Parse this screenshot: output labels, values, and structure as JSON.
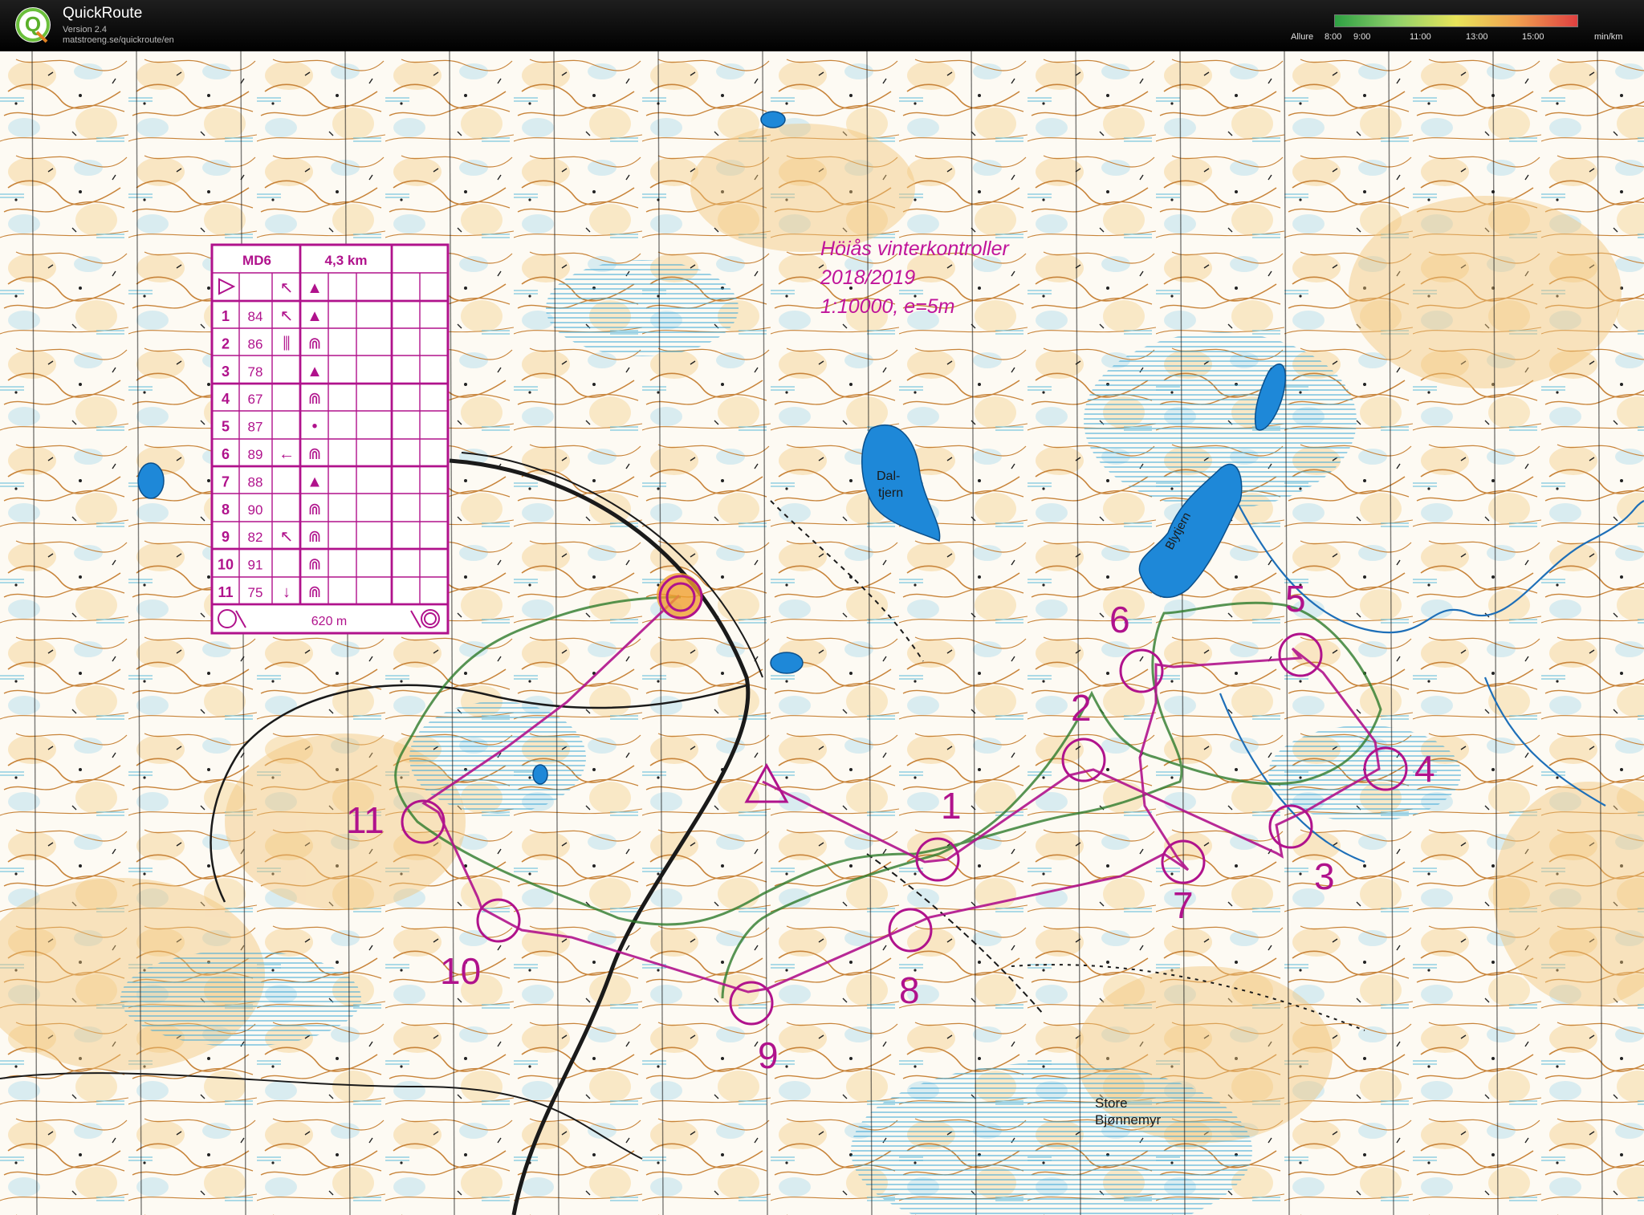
{
  "app": {
    "title": "QuickRoute",
    "version": "Version 2.4",
    "url": "matstroeng.se/quickroute/en"
  },
  "pace_scale": {
    "label": "Allure",
    "ticks": [
      "8:00",
      "9:00",
      "11:00",
      "13:00",
      "15:00"
    ],
    "unit": "min/km",
    "colors": [
      "#2ea043",
      "#8fd06a",
      "#e8e45a",
      "#f0a050",
      "#e04040"
    ]
  },
  "map": {
    "background_color": "#fdfbf6",
    "course_color": "#b0128c",
    "water_color": "#1e88d8",
    "note_lines": [
      "Höiås vinterkontroller",
      "2018/2019",
      "1:10000, e=5m"
    ],
    "place_labels": {
      "daltjern_1": "Dal-",
      "daltjern_2": "tjern",
      "blytjern": "Blytjern",
      "store_1": "Store",
      "store_2": "Bjønnemyr"
    },
    "controls": [
      "1",
      "2",
      "3",
      "4",
      "5",
      "6",
      "7",
      "8",
      "9",
      "10",
      "11"
    ]
  },
  "control_description": {
    "course": "MD6",
    "length": "4,3 km",
    "rows": [
      {
        "num": "1",
        "code": "84",
        "dir": "↖",
        "feature": "▲"
      },
      {
        "num": "2",
        "code": "86",
        "dir": "⫼",
        "feature": "⋒"
      },
      {
        "num": "3",
        "code": "78",
        "dir": "",
        "feature": "▲"
      },
      {
        "num": "4",
        "code": "67",
        "dir": "",
        "feature": "⋒"
      },
      {
        "num": "5",
        "code": "87",
        "dir": "",
        "feature": "•"
      },
      {
        "num": "6",
        "code": "89",
        "dir": "←",
        "feature": "⋒"
      },
      {
        "num": "7",
        "code": "88",
        "dir": "",
        "feature": "▲"
      },
      {
        "num": "8",
        "code": "90",
        "dir": "",
        "feature": "⋒"
      },
      {
        "num": "9",
        "code": "82",
        "dir": "↖",
        "feature": "⋒"
      },
      {
        "num": "10",
        "code": "91",
        "dir": "",
        "feature": "⋒"
      },
      {
        "num": "11",
        "code": "75",
        "dir": "↓",
        "feature": "⋒"
      }
    ],
    "start_dir": "↖",
    "start_feature": "▲",
    "finish_distance": "620 m"
  }
}
